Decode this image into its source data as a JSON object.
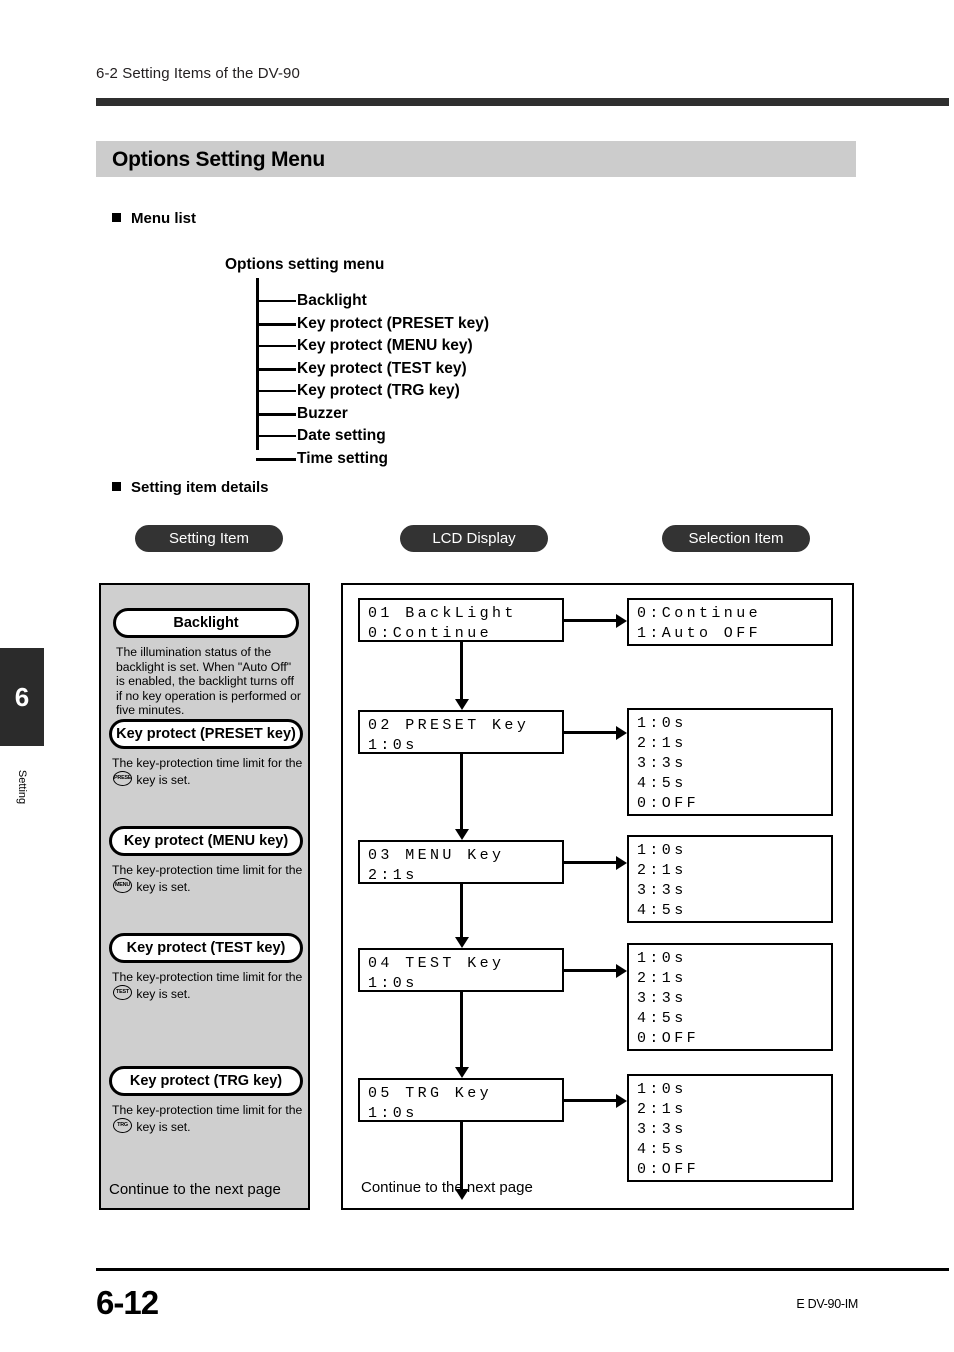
{
  "running_head": "6-2  Setting Items of the DV-90",
  "section_title": "Options Setting Menu",
  "headings": {
    "menu_list": "Menu list",
    "setting_item_details": "Setting item details"
  },
  "tree": {
    "root": "Options setting menu",
    "leaves": [
      "Backlight",
      "Key protect (PRESET key)",
      "Key protect (MENU key)",
      "Key protect (TEST key)",
      "Key protect (TRG key)",
      "Buzzer",
      "Date setting",
      "Time setting"
    ]
  },
  "column_headers": {
    "setting_item": "Setting Item",
    "lcd_display": "LCD Display",
    "selection_item": "Selection Item"
  },
  "setting_items": [
    {
      "pill": "Backlight",
      "desc_before": "The illumination status of the backlight is set. When \"Auto Off\" is enabled, the backlight turns off if no key operation is performed or five minutes.",
      "key_badge": "",
      "desc_after": ""
    },
    {
      "pill": "Key protect (PRESET key)",
      "desc_before": "The key-protection time limit for the ",
      "key_badge": "PRESET",
      "desc_after": " key is set."
    },
    {
      "pill": "Key protect (MENU key)",
      "desc_before": "The key-protection time limit for the ",
      "key_badge": "MENU",
      "desc_after": " key is set."
    },
    {
      "pill": "Key protect (TEST key)",
      "desc_before": "The key-protection time limit for the ",
      "key_badge": "TEST",
      "desc_after": " key is set."
    },
    {
      "pill": "Key protect (TRG key)",
      "desc_before": "The key-protection time limit for the ",
      "key_badge": "TRG",
      "desc_after": " key is set."
    }
  ],
  "continue_left": "Continue to the next page",
  "continue_right": "Continue to the next page",
  "flow": [
    {
      "lcd_line1": "01 BackLight",
      "lcd_line2": "0:Continue",
      "selections": [
        "0:Continue",
        "1:Auto OFF"
      ]
    },
    {
      "lcd_line1": "02 PRESET Key",
      "lcd_line2": "1:0s",
      "selections": [
        "1:0s",
        "2:1s",
        "3:3s",
        "4:5s",
        "0:OFF"
      ]
    },
    {
      "lcd_line1": "03 MENU Key",
      "lcd_line2": "2:1s",
      "selections": [
        "1:0s",
        "2:1s",
        "3:3s",
        "4:5s"
      ]
    },
    {
      "lcd_line1": "04 TEST Key",
      "lcd_line2": "1:0s",
      "selections": [
        "1:0s",
        "2:1s",
        "3:3s",
        "4:5s",
        "0:OFF"
      ]
    },
    {
      "lcd_line1": "05 TRG Key",
      "lcd_line2": "1:0s",
      "selections": [
        "1:0s",
        "2:1s",
        "3:3s",
        "4:5s",
        "0:OFF"
      ]
    }
  ],
  "thumb": {
    "number": "6",
    "label": "Setting"
  },
  "footer": {
    "page_number": "6-12",
    "doc_code": "E DV-90-IM"
  },
  "colors": {
    "band": "#cccccc",
    "panel_left": "#cfcfcf",
    "pill_dark": "#333333",
    "rule": "#2f2f2f"
  }
}
